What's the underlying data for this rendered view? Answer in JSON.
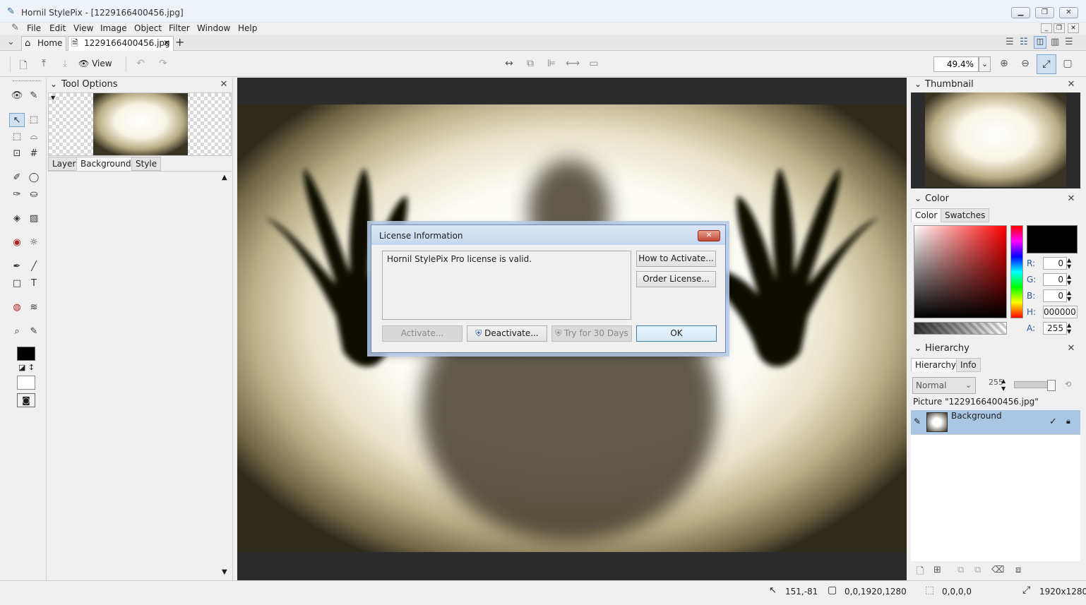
{
  "window": {
    "title": "Hornil StylePix - [1229166400456.jpg]"
  },
  "menu": [
    "File",
    "Edit",
    "View",
    "Image",
    "Object",
    "Filter",
    "Window",
    "Help"
  ],
  "tabs": {
    "home": "Home",
    "document": "1229166400456.jpg"
  },
  "toolbar": {
    "view_label": "View",
    "zoom_value": "49.4%"
  },
  "tool_options": {
    "title": "Tool Options",
    "tabs": [
      "Layer",
      "Background",
      "Style"
    ]
  },
  "dialog": {
    "title": "License Information",
    "message": "Hornil StylePix Pro license is valid.",
    "how_to_activate": "How to Activate...",
    "order_license": "Order License...",
    "activate": "Activate...",
    "deactivate": "Deactivate...",
    "try_30_days": "Try for 30 Days",
    "ok": "OK"
  },
  "thumbnail": {
    "title": "Thumbnail"
  },
  "color": {
    "title": "Color",
    "tabs": [
      "Color",
      "Swatches"
    ],
    "labels": {
      "r": "R:",
      "g": "G:",
      "b": "B:",
      "h": "H:",
      "a": "A:"
    },
    "r": "0",
    "g": "0",
    "b": "0",
    "hex": "000000",
    "a": "255",
    "current_hex": "#000000"
  },
  "hierarchy": {
    "title": "Hierarchy",
    "tabs": [
      "Hierarchy",
      "Info"
    ],
    "blend_mode": "Normal",
    "opacity": "255",
    "picture_label": "Picture \"1229166400456.jpg\"",
    "layer_name": "Background"
  },
  "status": {
    "cursor": "151,-81",
    "selection": "0,0,1920,1280",
    "region": "0,0,0,0",
    "size": "1920x1280"
  },
  "icons": [
    "pen-icon",
    "home-icon",
    "document-icon",
    "close-icon",
    "plus-icon",
    "eye-icon",
    "undo-icon",
    "redo-icon",
    "zoom-in-icon",
    "zoom-out-icon",
    "check-icon",
    "lock-icon",
    "cursor-icon"
  ]
}
